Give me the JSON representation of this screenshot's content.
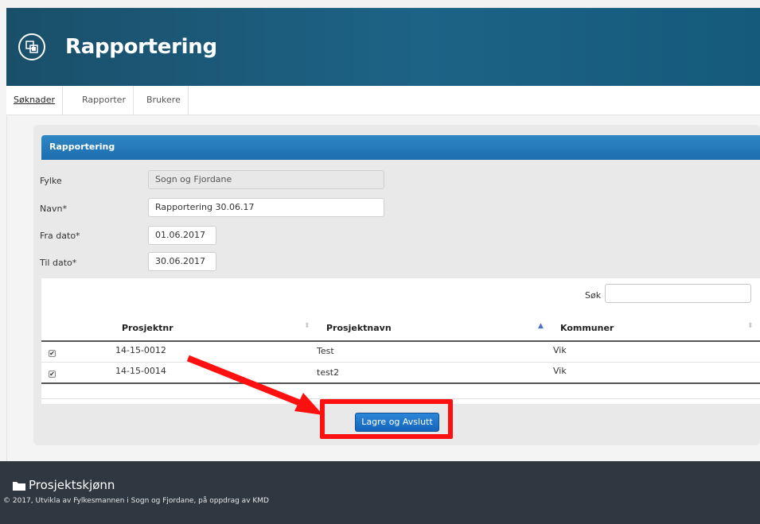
{
  "app": {
    "title": "Rapportering"
  },
  "nav": {
    "tabs": [
      "Søknader",
      "Rapporter",
      "Brukere"
    ],
    "active": "Søknader"
  },
  "panel": {
    "title": "Rapportering",
    "fields": [
      {
        "label": "Fylke",
        "value": "Sogn og Fjordane",
        "readonly": true
      },
      {
        "label": "Navn*",
        "value": "Rapportering 30.06.17",
        "readonly": false
      },
      {
        "label": "Fra dato*",
        "value": "01.06.2017",
        "readonly": false
      },
      {
        "label": "Til dato*",
        "value": "30.06.2017",
        "readonly": false
      }
    ]
  },
  "table": {
    "search_label": "Søk",
    "search_value": "",
    "columns": [
      "Prosjektnr",
      "Prosjektnavn",
      "Kommuner"
    ],
    "sorted_column": "Prosjektnavn",
    "sort_direction": "ascending",
    "rows": [
      {
        "checked": true,
        "prosjektnr": "14-15-0012",
        "prosjektnavn": "Test",
        "kommuner": "Vik"
      },
      {
        "checked": true,
        "prosjektnr": "14-15-0014",
        "prosjektnavn": "test2",
        "kommuner": "Vik"
      }
    ]
  },
  "actions": {
    "save_label": "Lagre og Avslutt"
  },
  "annotation": {
    "color": "#ff1010"
  },
  "footer": {
    "title": "Prosjektskjønn",
    "copyright": "© 2017, Utvikla av Fylkesmannen i Sogn og Fjordane, på oppdrag av KMD"
  },
  "colors": {
    "header": "#1d6386",
    "accent": "#1d6eaf",
    "footer": "#2f3841"
  }
}
